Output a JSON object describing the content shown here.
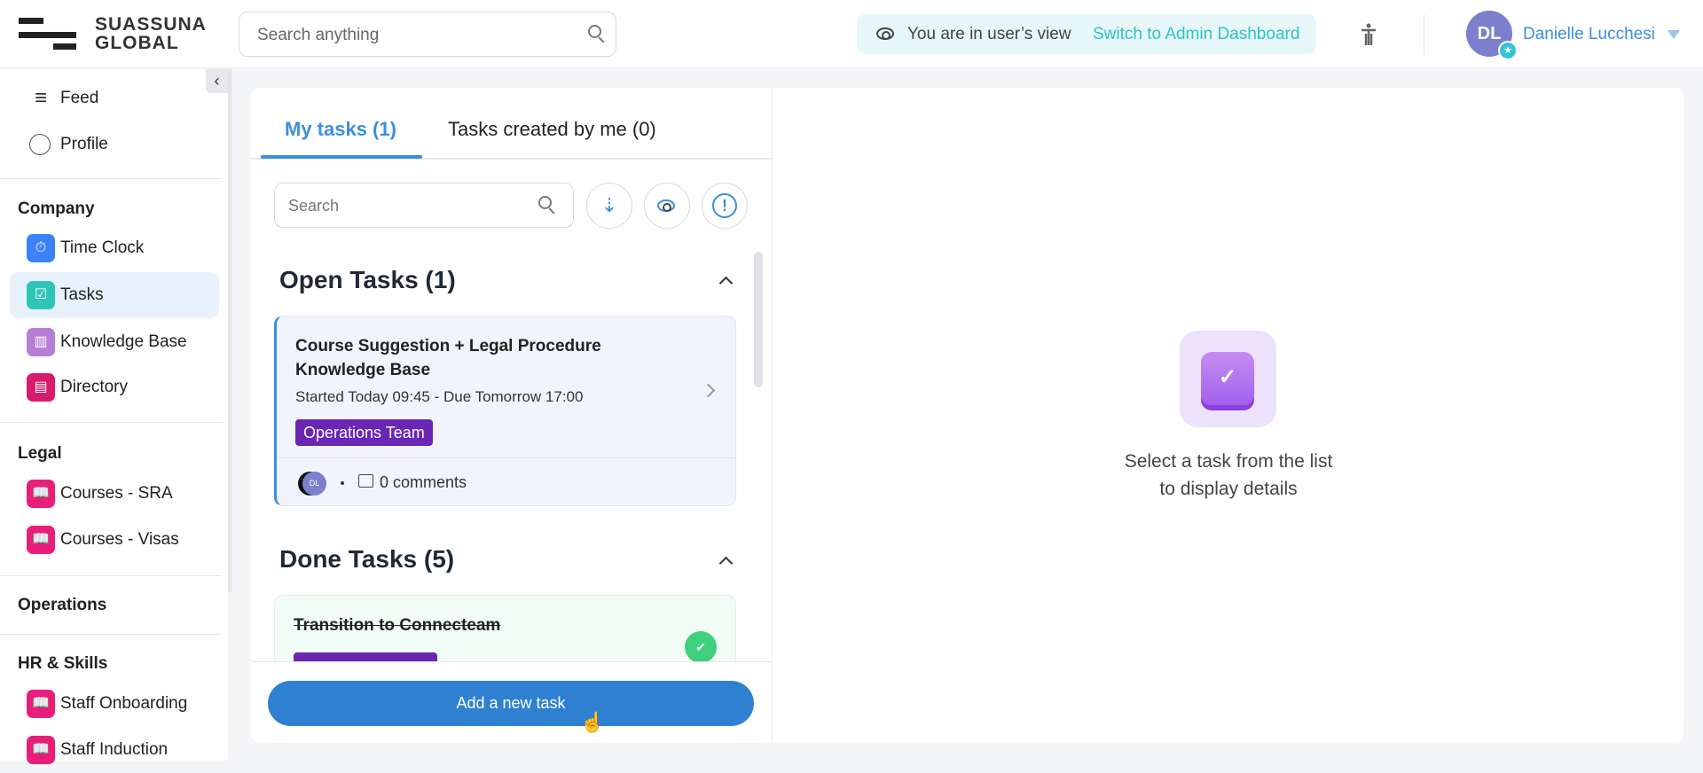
{
  "header": {
    "logo_lines": [
      "SUASSUNA",
      "GLOBAL"
    ],
    "search_placeholder": "Search anything",
    "view_notice": "You are in user’s view",
    "switch_link": "Switch to Admin Dashboard",
    "user_initials": "DL",
    "user_name": "Danielle Lucchesi"
  },
  "sidebar": {
    "top_items": [
      {
        "label": "Feed",
        "icon": "menu-icon"
      },
      {
        "label": "Profile",
        "icon": "user-icon"
      }
    ],
    "sections": [
      {
        "title": "Company",
        "items": [
          {
            "label": "Time Clock",
            "icon": "stopwatch-icon",
            "color": "#3b82f6"
          },
          {
            "label": "Tasks",
            "icon": "tasks-icon",
            "color": "#2ec4b6",
            "active": true
          },
          {
            "label": "Knowledge Base",
            "icon": "books-icon",
            "color": "#b57fd6"
          },
          {
            "label": "Directory",
            "icon": "contacts-icon",
            "color": "#d81b6a"
          }
        ]
      },
      {
        "title": "Legal",
        "items": [
          {
            "label": "Courses - SRA",
            "icon": "book-icon",
            "color": "#e91e7a"
          },
          {
            "label": "Courses - Visas",
            "icon": "book-icon",
            "color": "#e91e7a"
          }
        ]
      },
      {
        "title": "Operations",
        "items": []
      },
      {
        "title": "HR & Skills",
        "items": [
          {
            "label": "Staff Onboarding",
            "icon": "book-icon",
            "color": "#e91e7a"
          },
          {
            "label": "Staff Induction",
            "icon": "book-icon",
            "color": "#e91e7a"
          }
        ]
      }
    ]
  },
  "tasks": {
    "tabs": [
      {
        "label": "My tasks (1)",
        "active": true
      },
      {
        "label": "Tasks created by me (0)"
      }
    ],
    "search_placeholder": "Search",
    "open_heading": "Open Tasks (1)",
    "open_task": {
      "title": "Course Suggestion + Legal Procedure Knowledge Base",
      "meta": "Started Today 09:45 - Due Tomorrow 17:00",
      "badge": "Operations Team",
      "assignee_initials": "DL",
      "comments": "0 comments"
    },
    "done_heading": "Done Tasks (5)",
    "done_task": {
      "title": "Transition to Connecteam"
    },
    "add_button": "Add a new task"
  },
  "detail": {
    "empty_line1": "Select a task from the list",
    "empty_line2": "to display details"
  }
}
